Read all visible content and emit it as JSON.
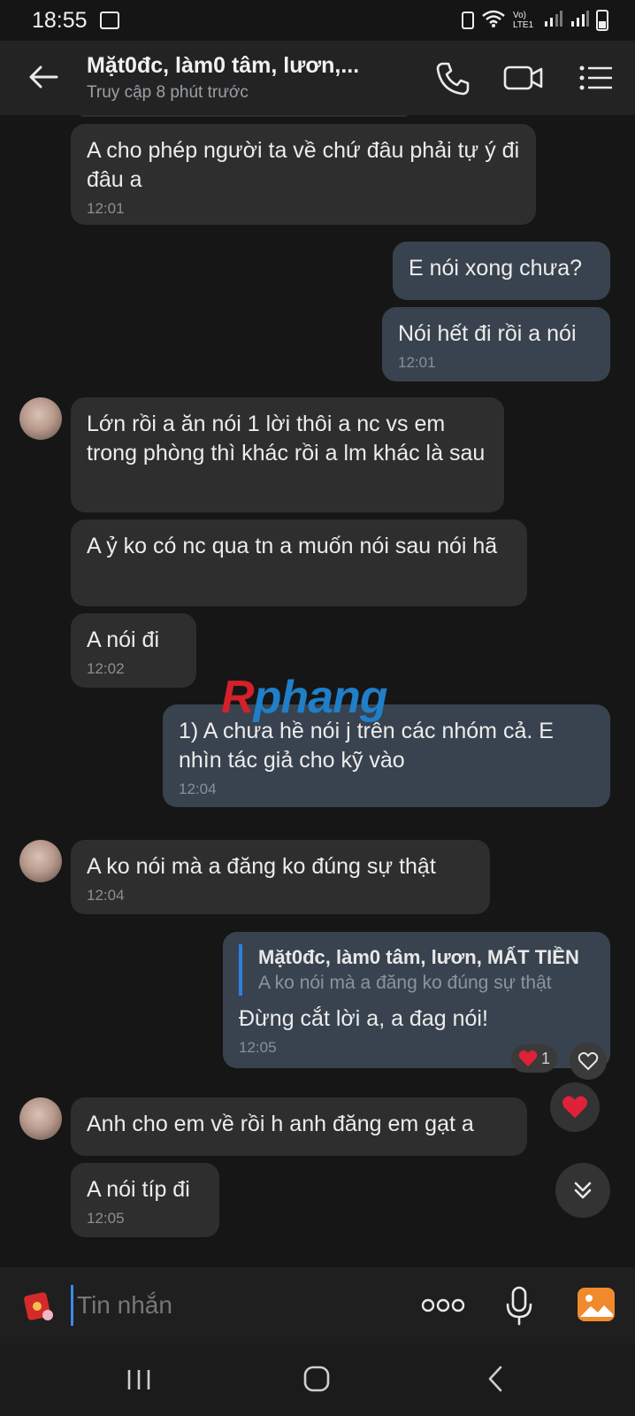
{
  "status_bar": {
    "time": "18:55",
    "network_label": "Vo) LTE1"
  },
  "header": {
    "title": "Mặt0đc, làm0 tâm, lươn,...",
    "subtitle": "Truy cập 8 phút trước"
  },
  "messages": [
    {
      "dir": "in",
      "text": "A cho phép người ta về chứ đâu phải tự ý đi đâu a",
      "time": "12:01"
    },
    {
      "dir": "out",
      "text": "E nói xong chưa?"
    },
    {
      "dir": "out",
      "text": "Nói hết đi rồi a nói",
      "time": "12:01"
    },
    {
      "dir": "in",
      "text": "Lớn rồi a ăn nói 1 lời thôi a nc vs em trong phòng thì khác rồi a lm khác là sau"
    },
    {
      "dir": "in",
      "text": "A ỷ ko có nc qua tn a muốn nói sau nói hã"
    },
    {
      "dir": "in",
      "text": "A nói đi",
      "time": "12:02"
    },
    {
      "dir": "out",
      "text": "1) A chưa hề nói j trên các nhóm cả. E nhìn tác giả cho kỹ vào",
      "time": "12:04"
    },
    {
      "dir": "in",
      "text": "A ko nói mà a đăng ko đúng sự thật",
      "time": "12:04"
    },
    {
      "dir": "out",
      "quote_name": "Mặt0đc, làm0 tâm, lươn, MẤT TIỀN",
      "quote_text": "A ko nói mà a đăng ko đúng sự thật",
      "text": "Đừng cắt lời a, a đag nói!",
      "time": "12:05",
      "reaction_count": "1"
    },
    {
      "dir": "in",
      "text": "Anh cho em về rồi h anh đăng em gạt a"
    },
    {
      "dir": "in",
      "text": "A nói típ đi",
      "time": "12:05"
    }
  ],
  "watermark": {
    "first": "R",
    "rest": "phang"
  },
  "composer": {
    "placeholder": "Tin nhắn"
  },
  "colors": {
    "accent": "#2f7fe0",
    "heart": "#e0213a",
    "gallery": "#f08a2c"
  }
}
